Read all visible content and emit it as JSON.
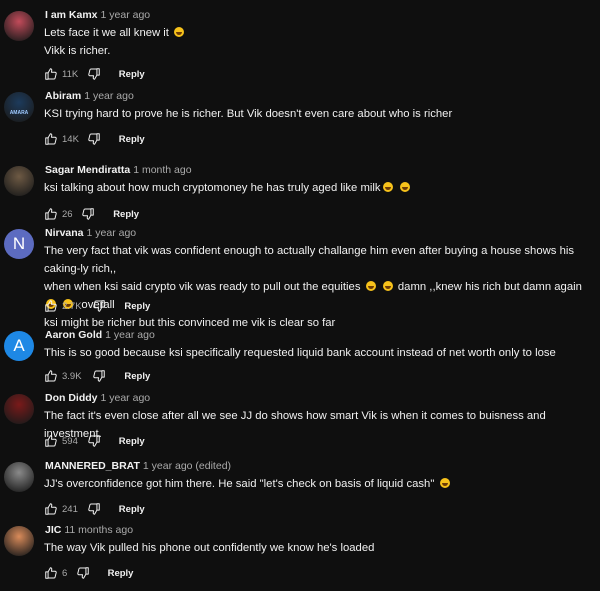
{
  "colors": {
    "background": "#0f0f0f",
    "text": "#f1f1f1",
    "muted": "#aaaaaa",
    "emoji": "#f7c21b"
  },
  "comments": [
    {
      "author": "I am Kamx",
      "time": "1 year ago",
      "lines": [
        "Lets face it we all knew it 😂",
        "Vikk is richer."
      ],
      "likes": "11K",
      "reply": "Reply",
      "avatar": {
        "type": "image",
        "color": "#c24b5a"
      }
    },
    {
      "author": "Abiram",
      "time": "1 year ago",
      "lines": [
        "KSI trying hard to prove he is richer. But Vik doesn't even care about who is richer"
      ],
      "likes": "14K",
      "reply": "Reply",
      "avatar": {
        "type": "image",
        "color": "#1d3b5c",
        "text": "AMARA"
      }
    },
    {
      "author": "Sagar Mendiratta",
      "time": "1 month ago",
      "lines": [
        "ksi talking about how much cryptomoney he has truly aged like milk😂 😂"
      ],
      "likes": "26",
      "reply": "Reply",
      "avatar": {
        "type": "image",
        "color": "#6e5a44"
      }
    },
    {
      "author": "Nirvana",
      "time": "1 year ago",
      "lines": [
        "The very fact that vik was confident enough to actually challange him even after buying a house shows his caking-ly rich,,",
        "when when ksi said crypto vik was ready to pull out the equities 😂 😂 damn ,,knew his rich but damn again 😂 😂  overall",
        "ksi might be richer but this convinced me vik is clear so far"
      ],
      "likes": "2.7K",
      "reply": "Reply",
      "avatar": {
        "type": "letter",
        "letter": "N",
        "color": "#5c6bc0"
      }
    },
    {
      "author": "Aaron Gold",
      "time": "1 year ago",
      "lines": [
        "This is so good because ksi specifically requested liquid bank account instead of net worth only to lose"
      ],
      "likes": "3.9K",
      "reply": "Reply",
      "avatar": {
        "type": "letter",
        "letter": "A",
        "color": "#1e88e5"
      }
    },
    {
      "author": "Don Diddy",
      "time": "1 year ago",
      "lines": [
        "The fact it's even close after all we see JJ do shows how smart Vik is when it comes to buisness and investment."
      ],
      "likes": "594",
      "reply": "Reply",
      "avatar": {
        "type": "image",
        "color": "#7a1a1a"
      }
    },
    {
      "author": "MANNERED_BRAT",
      "time": "1 year ago (edited)",
      "lines": [
        "JJ's overconfidence got him there. He said \"let's check on basis of liquid cash\" 😂"
      ],
      "likes": "241",
      "reply": "Reply",
      "avatar": {
        "type": "image",
        "color": "#8a8a8a"
      }
    },
    {
      "author": "JIC",
      "time": "11 months ago",
      "lines": [
        "The way Vik pulled his phone out confidently we know he's loaded"
      ],
      "likes": "6",
      "reply": "Reply",
      "avatar": {
        "type": "image",
        "color": "#d98b5a"
      }
    }
  ]
}
